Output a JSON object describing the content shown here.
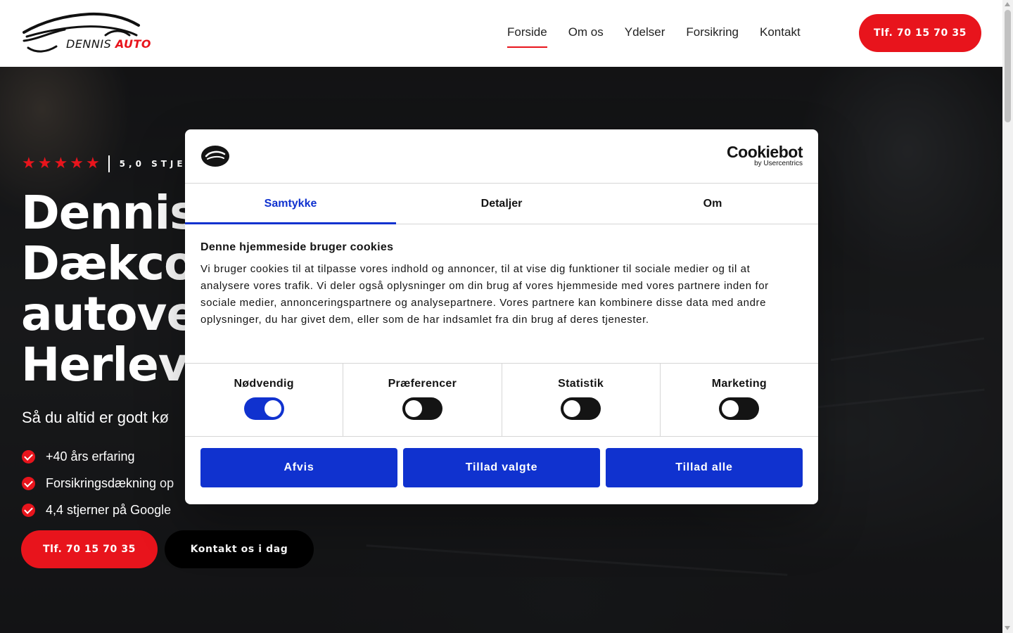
{
  "header": {
    "logo": {
      "word1": "DENNIS",
      "word2": "AUTO"
    },
    "nav": [
      {
        "label": "Forside",
        "active": true
      },
      {
        "label": "Om os",
        "active": false
      },
      {
        "label": "Ydelser",
        "active": false
      },
      {
        "label": "Forsikring",
        "active": false
      },
      {
        "label": "Kontakt",
        "active": false
      }
    ],
    "phone_button": "Tlf. 70 15 70 35"
  },
  "hero": {
    "stars": 5,
    "rating_text": "5,0 STJE",
    "title_lines": [
      "Dennis",
      "Dækco",
      "autove",
      "Herlev"
    ],
    "subtitle": "Så du altid er godt kø",
    "checks": [
      "+40 års erfaring",
      "Forsikringsdækning op",
      "4,4 stjerner på Google"
    ],
    "buttons": {
      "phone": "Tlf. 70 15 70 35",
      "contact": "Kontakt os i dag"
    }
  },
  "cookie_dialog": {
    "brand": {
      "name": "Cookiebot",
      "by": "by Usercentrics"
    },
    "tabs": [
      {
        "label": "Samtykke",
        "active": true
      },
      {
        "label": "Detaljer",
        "active": false
      },
      {
        "label": "Om",
        "active": false
      }
    ],
    "heading": "Denne hjemmeside bruger cookies",
    "body": "Vi bruger cookies til at tilpasse vores indhold og annoncer, til at vise dig funktioner til sociale medier og til at analysere vores trafik. Vi deler også oplysninger om din brug af vores hjemmeside med vores partnere inden for sociale medier, annonceringspartnere og analysepartnere. Vores partnere kan kombinere disse data med andre oplysninger, du har givet dem, eller som de har indsamlet fra din brug af deres tjenester.",
    "toggles": [
      {
        "label": "Nødvendig",
        "on": true
      },
      {
        "label": "Præferencer",
        "on": false
      },
      {
        "label": "Statistik",
        "on": false
      },
      {
        "label": "Marketing",
        "on": false
      }
    ],
    "buttons": {
      "reject": "Afvis",
      "allow_selected": "Tillad valgte",
      "allow_all": "Tillad alle"
    }
  },
  "colors": {
    "brand_red": "#e8141c",
    "cookiebot_blue": "#1032cf",
    "text_dark": "#141414"
  }
}
